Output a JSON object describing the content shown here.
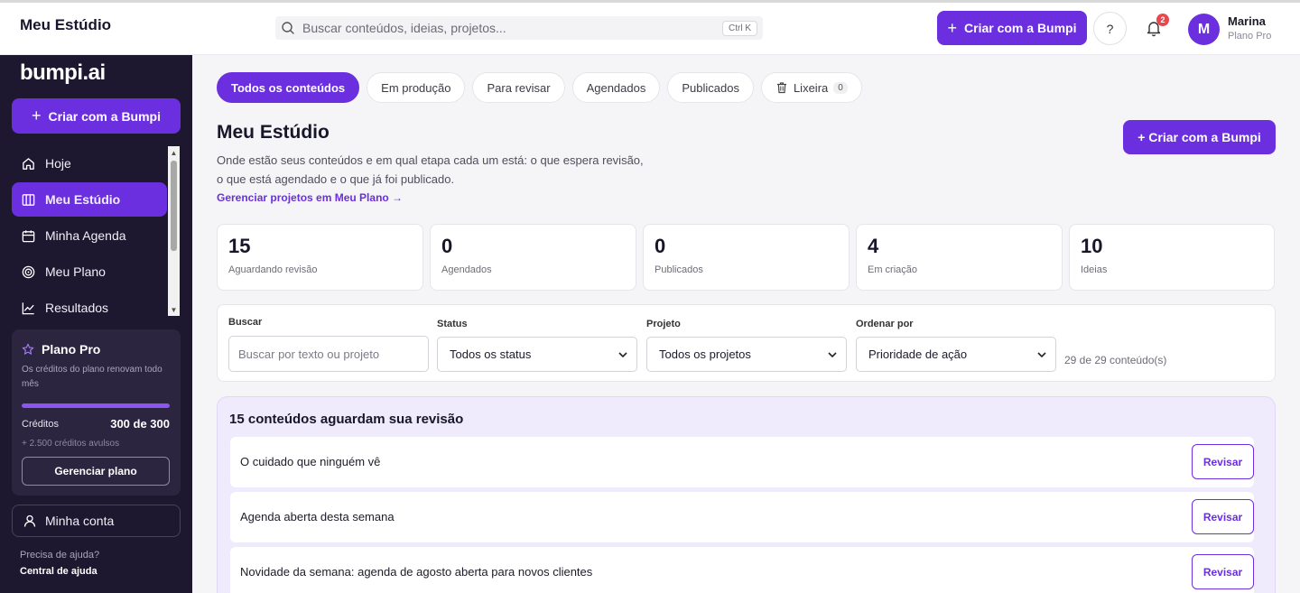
{
  "header": {
    "title": "Meu Estúdio",
    "search_placeholder": "Buscar conteúdos, ideias, projetos...",
    "search_shortcut": "Ctrl K",
    "create_label": "Criar com a Bumpi",
    "help_label": "?",
    "notification_count": "2",
    "user": {
      "initial": "M",
      "name": "Marina",
      "plan": "Plano Pro"
    }
  },
  "sidebar": {
    "logo": "bumpi.ai",
    "create_label": "Criar com a Bumpi",
    "items": [
      {
        "label": "Hoje",
        "icon": "home-icon",
        "active": false
      },
      {
        "label": "Meu Estúdio",
        "icon": "board-icon",
        "active": true
      },
      {
        "label": "Minha Agenda",
        "icon": "calendar-icon",
        "active": false
      },
      {
        "label": "Meu Plano",
        "icon": "target-icon",
        "active": false
      },
      {
        "label": "Resultados",
        "icon": "chart-icon",
        "active": false
      }
    ],
    "plan": {
      "title": "Plano Pro",
      "description": "Os créditos do plano renovam todo mês",
      "credits_label": "Créditos",
      "credits_value": "300 de 300",
      "credits_fraction": 1.0,
      "extra_credits": "+ 2.500 créditos avulsos",
      "manage_label": "Gerenciar plano"
    },
    "account_label": "Minha conta",
    "help_question": "Precisa de ajuda?",
    "help_link": "Central de ajuda"
  },
  "tabs": [
    {
      "label": "Todos os conteúdos",
      "active": true
    },
    {
      "label": "Em produção",
      "active": false
    },
    {
      "label": "Para revisar",
      "active": false
    },
    {
      "label": "Agendados",
      "active": false
    },
    {
      "label": "Publicados",
      "active": false
    },
    {
      "label": "Lixeira",
      "active": false,
      "icon": "trash-icon",
      "count": "0"
    }
  ],
  "page": {
    "title": "Meu Estúdio",
    "description": "Onde estão seus conteúdos e em qual etapa cada um está: o que espera revisão, o que está agendado e o que já foi publicado.",
    "plan_link": "Gerenciar projetos em Meu Plano →",
    "create_label": "+ Criar com a Bumpi"
  },
  "stats": [
    {
      "value": "15",
      "label": "Aguardando revisão"
    },
    {
      "value": "0",
      "label": "Agendados"
    },
    {
      "value": "0",
      "label": "Publicados"
    },
    {
      "value": "4",
      "label": "Em criação"
    },
    {
      "value": "10",
      "label": "Ideias"
    }
  ],
  "filters": {
    "search_label": "Buscar",
    "search_placeholder": "Buscar por texto ou projeto",
    "status_label": "Status",
    "status_value": "Todos os status",
    "project_label": "Projeto",
    "project_value": "Todos os projetos",
    "sort_label": "Ordenar por",
    "sort_value": "Prioridade de ação",
    "count_text": "29 de 29 conteúdo(s)"
  },
  "review": {
    "title": "15 conteúdos aguardam sua revisão",
    "button_label": "Revisar",
    "items": [
      "O cuidado que ninguém vê",
      "Agenda aberta desta semana",
      "Novidade da semana: agenda de agosto aberta para novos clientes"
    ]
  },
  "colors": {
    "accent": "#6b2fe0",
    "sidebar_bg": "#1d1830",
    "review_bg": "#efeafc",
    "badge": "#e5484d"
  }
}
